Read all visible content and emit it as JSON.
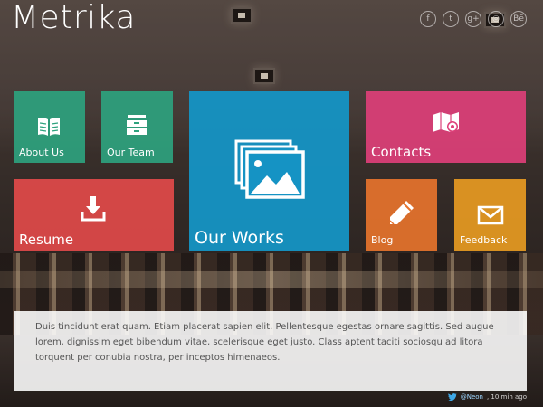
{
  "site": {
    "title": "Metrika"
  },
  "social": [
    {
      "name": "facebook",
      "glyph": "f"
    },
    {
      "name": "twitter",
      "glyph": "t"
    },
    {
      "name": "google-plus",
      "glyph": "g+"
    },
    {
      "name": "dribbble",
      "glyph": "◎"
    },
    {
      "name": "behance",
      "glyph": "Bē"
    }
  ],
  "tiles": {
    "about": {
      "label": "About Us",
      "icon": "book-icon",
      "color": "#2ea27e"
    },
    "team": {
      "label": "Our Team",
      "icon": "cabinet-icon",
      "color": "#2ea27e"
    },
    "works": {
      "label": "Our Works",
      "icon": "images-icon",
      "color": "#1593c4"
    },
    "contacts": {
      "label": "Contacts",
      "icon": "map-pin-icon",
      "color": "#dd3f78"
    },
    "resume": {
      "label": "Resume",
      "icon": "download-icon",
      "color": "#e44a4a"
    },
    "blog": {
      "label": "Blog",
      "icon": "pencil-icon",
      "color": "#e6732d"
    },
    "feedback": {
      "label": "Feedback",
      "icon": "envelope-icon",
      "color": "#e79a22"
    }
  },
  "content": {
    "text": "Duis tincidunt erat quam. Etiam placerat sapien elit. Pellentesque egestas ornare sagittis. Sed augue lorem, dignissim eget bibendum vitae, scelerisque eget justo. Class aptent taciti sociosqu ad litora torquent per conubia nostra, per inceptos himenaeos."
  },
  "tweet": {
    "handle": "@Neon",
    "time": ", 10 min ago"
  }
}
